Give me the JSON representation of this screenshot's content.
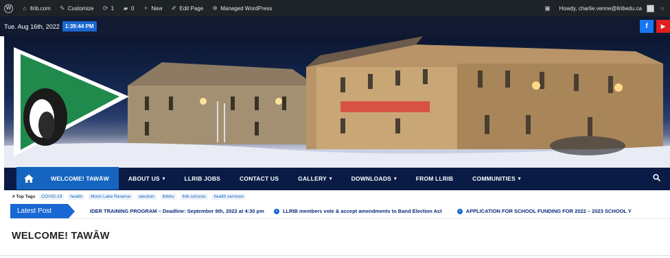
{
  "adminbar": {
    "site": "llrib.com",
    "customize": "Customize",
    "updates": "1",
    "comments": "0",
    "new": "New",
    "edit": "Edit Page",
    "managed": "Managed WordPress",
    "howdy": "Howdy, charlie.venne@llribedu.ca"
  },
  "topbar": {
    "date": "Tue. Aug 16th, 2022",
    "time": "1:39:44 PM"
  },
  "social": {
    "facebook_icon": "f",
    "youtube_icon": "▶"
  },
  "nav": {
    "items": [
      {
        "label": "WELCOME! TAWĀW",
        "caret": false
      },
      {
        "label": "ABOUT US",
        "caret": true
      },
      {
        "label": "LLRIB JOBS",
        "caret": false
      },
      {
        "label": "CONTACT US",
        "caret": false
      },
      {
        "label": "GALLERY",
        "caret": true
      },
      {
        "label": "DOWNLOADS",
        "caret": true
      },
      {
        "label": "FROM LLRIB",
        "caret": false
      },
      {
        "label": "COMMUNITIES",
        "caret": true
      }
    ],
    "caret_glyph": "▾"
  },
  "tags": {
    "label": "# Top Tags",
    "items": [
      "COVID-19",
      "health",
      "Morin Lake Reserve",
      "election",
      "llribhs",
      "llrib schools",
      "health services"
    ]
  },
  "ticker": {
    "label": "Latest Post",
    "items": [
      "IDER TRAINING PROGRAM – Deadline: September 8th, 2022 at 4:30 pm",
      "LLRIB members vote & accept amendments to Band Election Act",
      "APPLICATION FOR SCHOOL FUNDING FOR 2022 – 2023 SCHOOL Y"
    ]
  },
  "page": {
    "title": "WELCOME! TAWĀW"
  },
  "colors": {
    "adminbar": "#1d2327",
    "topbar": "#111a30",
    "nav": "#0a1c46",
    "accent": "#1565c0"
  }
}
